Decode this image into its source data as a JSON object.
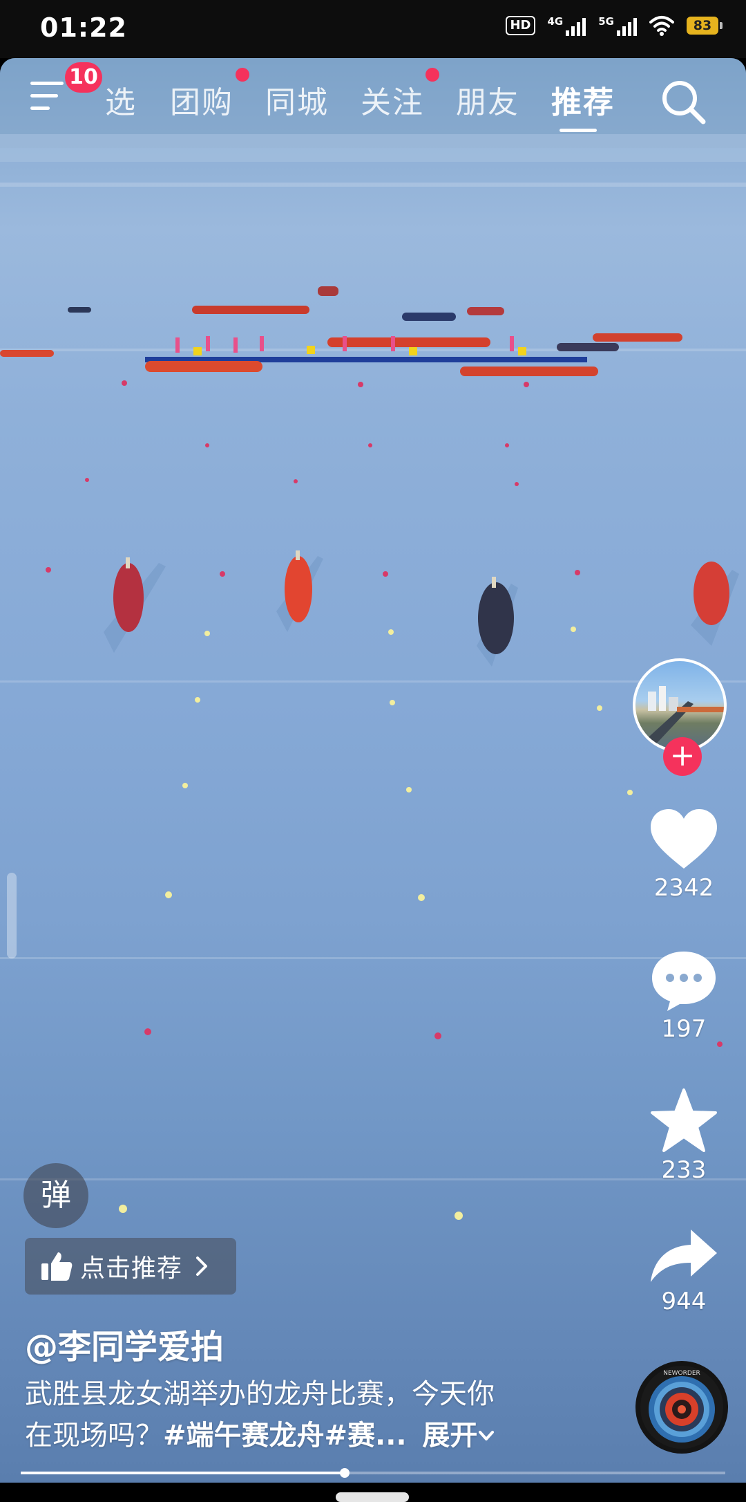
{
  "status_bar": {
    "time": "01:22",
    "hd_label": "HD",
    "network_1": "4G",
    "network_2": "5G",
    "battery": "83",
    "battery_color": "#e6b31e"
  },
  "top_nav": {
    "badge_count": "10",
    "tabs": [
      {
        "label": "选",
        "active": false
      },
      {
        "label": "团购",
        "active": false,
        "dot": true
      },
      {
        "label": "同城",
        "active": false
      },
      {
        "label": "关注",
        "active": false,
        "dot": true
      },
      {
        "label": "朋友",
        "active": false
      },
      {
        "label": "推荐",
        "active": true
      }
    ],
    "accent": "#f5325c"
  },
  "right_rail": {
    "likes": "2342",
    "comments": "197",
    "favorites": "233",
    "shares": "944",
    "disc_text": "NEWORDER"
  },
  "bottom": {
    "danmu_label": "弹",
    "recommend_label": "点击推荐",
    "author": "@李同学爱拍",
    "caption_line1": "武胜县龙女湖举办的龙舟比赛，今天你",
    "caption_line2_plain": "在现场吗？",
    "caption_line2_tags": "#端午赛龙舟#赛...",
    "expand_label": "展开",
    "progress_fraction": 0.46
  },
  "icons": [
    "menu-icon",
    "search-icon",
    "heart-icon",
    "comment-icon",
    "star-icon",
    "share-icon",
    "thumbs-up-icon",
    "chevron-right-icon",
    "chevron-down-icon",
    "plus-icon",
    "wifi-icon"
  ]
}
